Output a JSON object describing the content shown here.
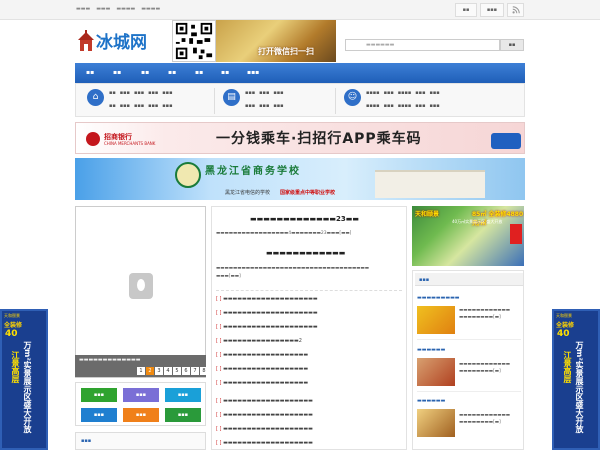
{
  "top": {
    "links": [
      "",
      "",
      "",
      ""
    ],
    "buttons": [
      "",
      "",
      ""
    ]
  },
  "logo": {
    "text": "冰城网"
  },
  "wx_banner": {
    "text": "打开微信扫一扫"
  },
  "search": {
    "placeholder": "",
    "button": ""
  },
  "nav": {
    "items": [
      "",
      "",
      "",
      "",
      "",
      "",
      "",
      ""
    ]
  },
  "ads": {
    "cmb_bank": "招商银行",
    "cmb_bank_sub": "CHINA MERCHANTS BANK",
    "cmb_slogan": "一分钱乘车·扫招行APP乘车码",
    "school_name": "黑龙江省商务学校",
    "school_sub": "黑龙江省电信的学校",
    "school_sub2": "国家级重点中等职业学校",
    "right_ad_1": "天和颐景",
    "right_ad_2": "85㎡ 全装修4880元/㎡",
    "right_ad_3": "40万㎡实景展示区 盛大开放",
    "side_top": "天和颐景",
    "side_sub": "全装修",
    "side_big": "40",
    "side_v1": "万m²实景展示区盛大开放",
    "side_v2": "江景高层"
  },
  "slider": {
    "caption": "",
    "dots": [
      "1",
      "2",
      "3",
      "4",
      "5",
      "6",
      "7",
      "8"
    ]
  },
  "news": {
    "headline_num": "23",
    "summary1_num": "4",
    "summary1_num2": "23",
    "headline2": "",
    "item_cat": "[  ]",
    "item_num": "2"
  },
  "colors": {
    "nav_blue": "#2a6bc8",
    "link_blue": "#2a64b0",
    "orange": "#f08a10",
    "red": "#d03030",
    "ql_1": "#2fa32f",
    "ql_2": "#7a6fd6",
    "ql_3": "#1aa0d8",
    "ql_4": "#1f7fd0",
    "ql_5": "#f0801a",
    "ql_6": "#2a9a3a"
  }
}
